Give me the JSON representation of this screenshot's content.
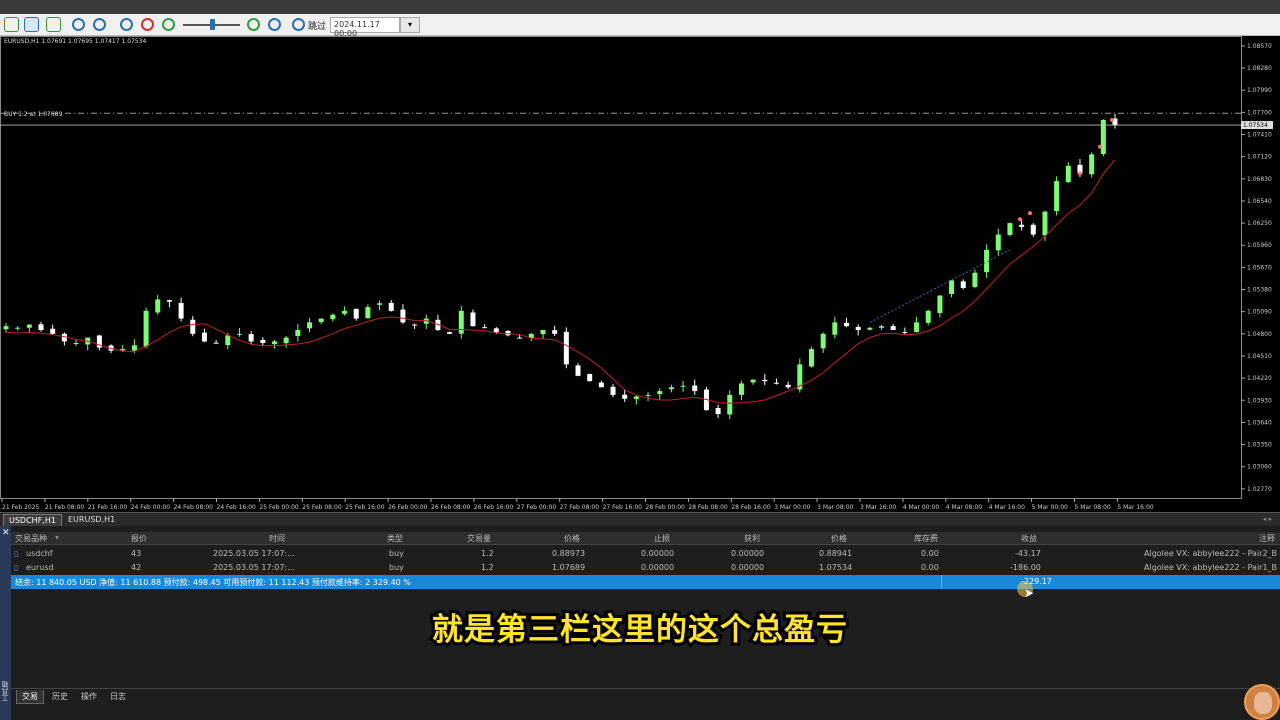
{
  "toolbar": {
    "skip_label": "跳过",
    "date_value": "2024.11.17 00:00"
  },
  "chart": {
    "title": "EURUSD,H1  1.07691 1.07695 1.07417 1.07534",
    "trade_label": "BUY 1.2 at 1.07689",
    "current_price_label": "1.07534",
    "price_ticks": [
      "1.08570",
      "1.08280",
      "1.07990",
      "1.07700",
      "1.07410",
      "1.07120",
      "1.06830",
      "1.06540",
      "1.06250",
      "1.05960",
      "1.05670",
      "1.05380",
      "1.05090",
      "1.04800",
      "1.04510",
      "1.04220",
      "1.03930",
      "1.03640",
      "1.03350",
      "1.03060",
      "1.02770"
    ],
    "time_ticks": [
      "21 Feb 2025",
      "21 Feb 08:00",
      "21 Feb 16:00",
      "24 Feb 00:00",
      "24 Feb 08:00",
      "24 Feb 16:00",
      "25 Feb 00:00",
      "25 Feb 08:00",
      "25 Feb 16:00",
      "26 Feb 00:00",
      "26 Feb 08:00",
      "26 Feb 16:00",
      "27 Feb 00:00",
      "27 Feb 08:00",
      "27 Feb 16:00",
      "28 Feb 00:00",
      "28 Feb 08:00",
      "28 Feb 16:00",
      "3 Mar 00:00",
      "3 Mar 08:00",
      "3 Mar 16:00",
      "4 Mar 00:00",
      "4 Mar 08:00",
      "4 Mar 16:00",
      "5 Mar 00:00",
      "5 Mar 08:00",
      "5 Mar 16:00"
    ],
    "colors": {
      "bull": "#7cfc74",
      "bear": "#ffffff",
      "ma": "#c0202a",
      "grid": "#333333"
    }
  },
  "chart_data": {
    "type": "candlestick",
    "symbol": "EURUSD",
    "timeframe": "H1",
    "ylim": [
      1.0265,
      1.087
    ],
    "close_path": [
      1.049,
      1.0488,
      1.0492,
      1.0485,
      1.048,
      1.047,
      1.0468,
      1.0475,
      1.0462,
      1.0458,
      1.046,
      1.0465,
      1.051,
      1.0525,
      1.0522,
      1.05,
      1.048,
      1.047,
      1.0468,
      1.0478,
      1.048,
      1.047,
      1.0468,
      1.047,
      1.0475,
      1.0485,
      1.0495,
      1.05,
      1.0505,
      1.051,
      1.05,
      1.0515,
      1.052,
      1.051,
      1.0495,
      1.0492,
      1.05,
      1.0485,
      1.048,
      1.051,
      1.049,
      1.0488,
      1.0482,
      1.0478,
      1.0475,
      1.048,
      1.0485,
      1.048,
      1.044,
      1.0425,
      1.0418,
      1.041,
      1.04,
      1.0395,
      1.0398,
      1.04,
      1.0405,
      1.041,
      1.0412,
      1.0405,
      1.038,
      1.0375,
      1.04,
      1.0415,
      1.042,
      1.0418,
      1.0415,
      1.041,
      1.044,
      1.046,
      1.048,
      1.0495,
      1.049,
      1.0485,
      1.0488,
      1.049,
      1.0485,
      1.0482,
      1.0495,
      1.051,
      1.053,
      1.055,
      1.054,
      1.056,
      1.059,
      1.061,
      1.0625,
      1.062,
      1.061,
      1.064,
      1.068,
      1.07,
      1.069,
      1.0715,
      1.076,
      1.0753
    ],
    "moving_average": true,
    "trade_line": 1.07689,
    "bid_line": 1.07534
  },
  "terminal": {
    "close_icon": "✕",
    "side_label": "工具箱",
    "headers": [
      "交易品种",
      "报价",
      "时间",
      "类型",
      "交易量",
      "价格",
      "止损",
      "获利",
      "价格",
      "库存费",
      "收益",
      "注释"
    ],
    "rows": [
      {
        "symbol": "usdchf",
        "ticket": "43",
        "time": "2025.03.05 17:07:...",
        "type": "buy",
        "volume": "1.2",
        "open_price": "0.88973",
        "sl": "0.00000",
        "tp": "0.00000",
        "price": "0.88941",
        "swap": "0.00",
        "profit": "-43.17",
        "comment": "Algolee VX:  abbylee222 - Pair2_B"
      },
      {
        "symbol": "eurusd",
        "ticket": "42",
        "time": "2025.03.05 17:07:...",
        "type": "buy",
        "volume": "1.2",
        "open_price": "1.07689",
        "sl": "0.00000",
        "tp": "0.00000",
        "price": "1.07534",
        "swap": "0.00",
        "profit": "-186.00",
        "comment": "Algolee VX:  abbylee222 - Pair1_B"
      }
    ],
    "summary": "结余: 11 840.05 USD  净值: 11 610.88  预付款: 498.45  可用预付款: 11 112.43  预付款维持率: 2 329.40 %",
    "total_profit": "-229.17",
    "bottom_tabs": [
      "交易",
      "历史",
      "操作",
      "日志"
    ]
  },
  "chart_tabs": [
    "USDCHF,H1",
    "EURUSD,H1"
  ],
  "subtitle": "就是第三栏这里的这个总盈亏"
}
